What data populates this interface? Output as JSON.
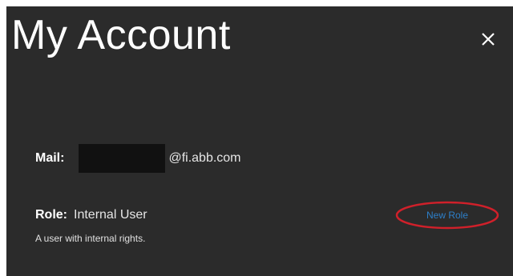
{
  "dialog": {
    "title": "My Account",
    "close_icon": "close-icon"
  },
  "mail": {
    "label": "Mail:",
    "domain": "@fi.abb.com"
  },
  "role": {
    "label": "Role:",
    "value": "Internal User",
    "description": "A user with internal rights.",
    "new_role_link": "New Role"
  },
  "colors": {
    "background": "#2b2b2b",
    "text": "#ffffff",
    "link": "#2d7fc9",
    "highlight_circle": "#d0202a",
    "redaction": "#111111"
  }
}
